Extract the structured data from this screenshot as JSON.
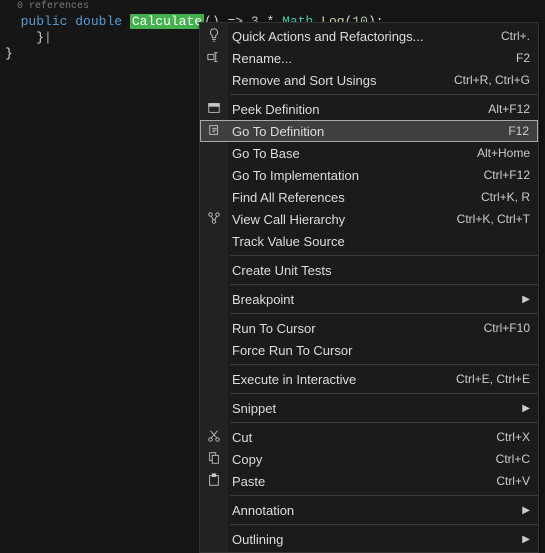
{
  "code": {
    "codelens": "0 references",
    "line1": {
      "kw1": "public",
      "kw2": "double",
      "method": "Calculate",
      "parens": "()",
      "arrow": " => ",
      "num1": "3",
      "star": " * ",
      "cls": "Math",
      "dot": ".",
      "mth": "Log",
      "open": "(",
      "num2": "10",
      "close": ")",
      "semi": ";"
    },
    "line2": "    }",
    "line3": "}"
  },
  "menu": {
    "items": [
      {
        "label": "Quick Actions and Refactorings...",
        "shortcut": "Ctrl+.",
        "icon": "bulb"
      },
      {
        "label": "Rename...",
        "shortcut": "F2",
        "icon": "rename"
      },
      {
        "label": "Remove and Sort Usings",
        "shortcut": "Ctrl+R, Ctrl+G"
      },
      {
        "sep": true
      },
      {
        "label": "Peek Definition",
        "shortcut": "Alt+F12",
        "icon": "peek"
      },
      {
        "label": "Go To Definition",
        "shortcut": "F12",
        "icon": "goto",
        "selected": true
      },
      {
        "label": "Go To Base",
        "shortcut": "Alt+Home"
      },
      {
        "label": "Go To Implementation",
        "shortcut": "Ctrl+F12"
      },
      {
        "label": "Find All References",
        "shortcut": "Ctrl+K, R"
      },
      {
        "label": "View Call Hierarchy",
        "shortcut": "Ctrl+K, Ctrl+T",
        "icon": "hierarchy"
      },
      {
        "label": "Track Value Source"
      },
      {
        "sep": true
      },
      {
        "label": "Create Unit Tests"
      },
      {
        "sep": true
      },
      {
        "label": "Breakpoint",
        "submenu": true
      },
      {
        "sep": true
      },
      {
        "label": "Run To Cursor",
        "shortcut": "Ctrl+F10"
      },
      {
        "label": "Force Run To Cursor"
      },
      {
        "sep": true
      },
      {
        "label": "Execute in Interactive",
        "shortcut": "Ctrl+E, Ctrl+E"
      },
      {
        "sep": true
      },
      {
        "label": "Snippet",
        "submenu": true
      },
      {
        "sep": true
      },
      {
        "label": "Cut",
        "shortcut": "Ctrl+X",
        "icon": "cut"
      },
      {
        "label": "Copy",
        "shortcut": "Ctrl+C",
        "icon": "copy"
      },
      {
        "label": "Paste",
        "shortcut": "Ctrl+V",
        "icon": "paste"
      },
      {
        "sep": true
      },
      {
        "label": "Annotation",
        "submenu": true
      },
      {
        "sep": true
      },
      {
        "label": "Outlining",
        "submenu": true
      }
    ]
  }
}
